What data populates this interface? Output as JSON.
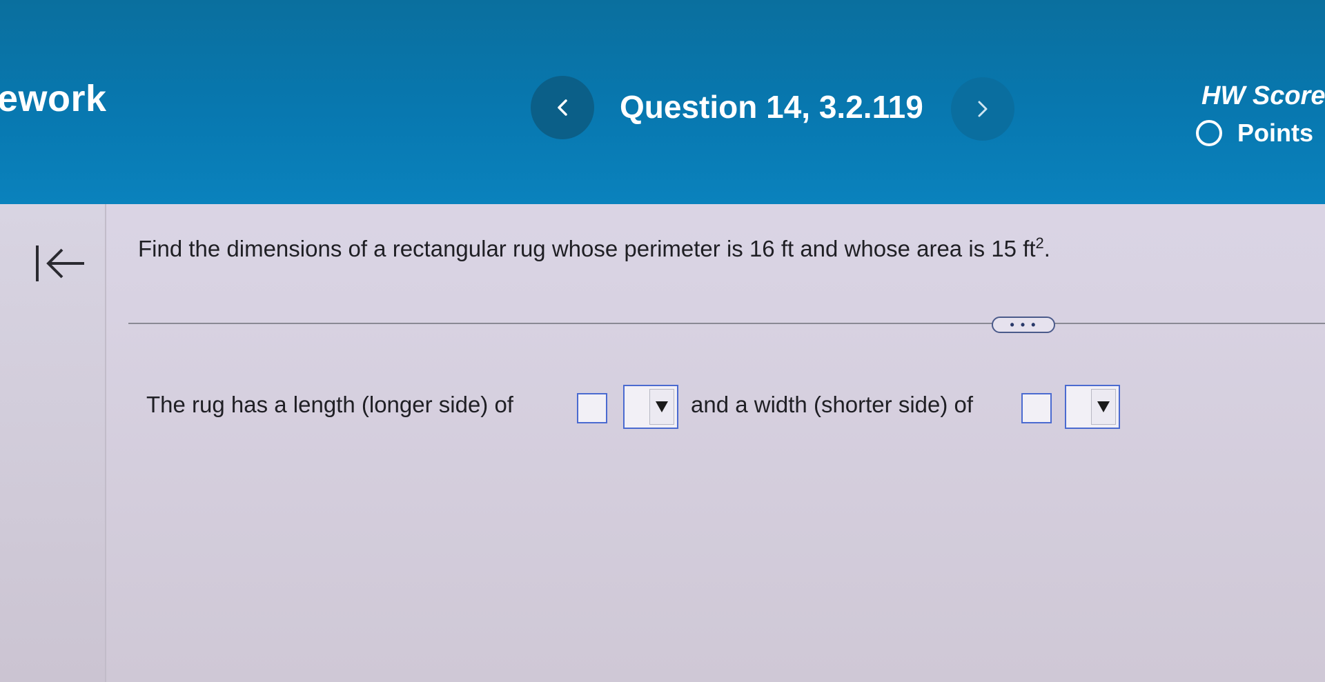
{
  "header": {
    "left_title": "ework",
    "question_title": "Question 14, 3.2.119",
    "hw_score_label": "HW Score:",
    "points_label": "Points"
  },
  "question": {
    "prompt": "Find the dimensions of a rectangular rug whose perimeter is 16 ft and whose area is 15 ft",
    "exponent": "2",
    "trailing": "."
  },
  "answer": {
    "part1": "The rug has a length (longer side) of",
    "part2": "and a width (shorter side) of",
    "more_button": "• • •"
  },
  "colors": {
    "header": "#0878b0",
    "accent_box": "#4a6ad0"
  }
}
